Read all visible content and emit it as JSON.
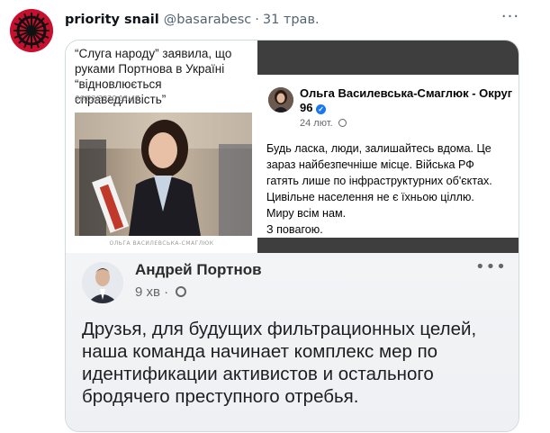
{
  "tweet": {
    "author_name": "priority snail",
    "author_handle": "@basarabesc",
    "separator": "·",
    "date": "31 трав.",
    "more_icon": "more-horizontal-icon"
  },
  "news": {
    "title_lines": [
      "“Слуга народу” заявила, що",
      "руками Портнова в Україні",
      "“відновлюється справедливість”"
    ],
    "date": "06/03/2020 13:47",
    "caption": "ОЛЬГА ВАСИЛЕВСЬКА-СМАГЛЮК"
  },
  "fb_post": {
    "author": "Ольга Василевська-Смаглюк - Округ 96",
    "time": "24 лют.",
    "text_lines": [
      "Будь ласка, люди, залишайтесь вдома. Це",
      "зараз найбезпечніше місце. Війська РФ",
      "гатять лише по інфраструктурних об'єктах.",
      "Цивільне населення не є їхньою ціллю.",
      "Миру всім нам.",
      "З повагою."
    ]
  },
  "portnov_post": {
    "author": "Андрей Портнов",
    "time": "9 хв",
    "separator": "·",
    "text_lines": [
      "Друзья, для будущих фильтрационных целей,",
      "наша команда начинает комплекс мер по",
      "идентификации активистов и остального",
      "бродячего преступного отребья."
    ]
  },
  "colors": {
    "avatar_red": "#c8102e",
    "twitter_grey": "#536471",
    "fb_blue": "#1877f2"
  }
}
